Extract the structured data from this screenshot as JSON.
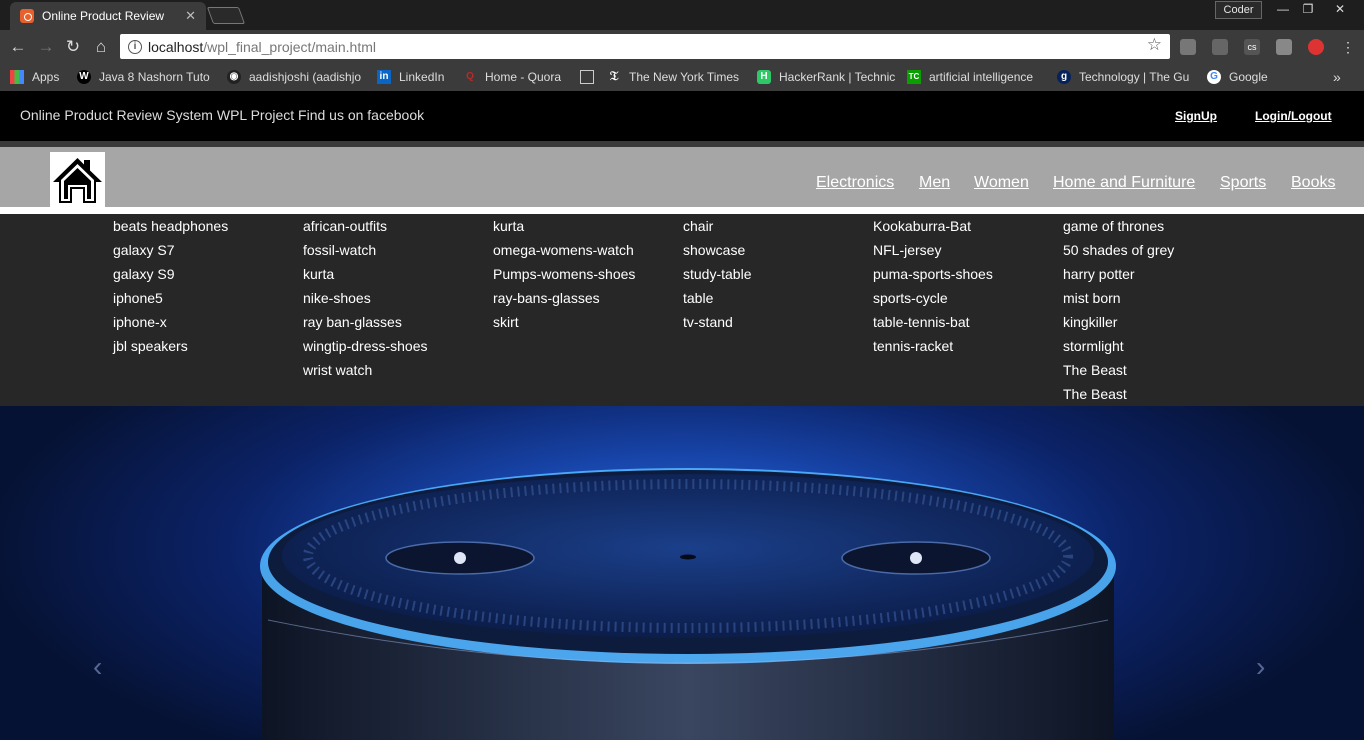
{
  "browser": {
    "tab_title": "Online Product Review",
    "profile": "Coder",
    "url_host": "localhost",
    "url_path": "/wpl_final_project/main.html",
    "bookmarks": [
      {
        "label": "Apps",
        "icon": "apps-grid-icon"
      },
      {
        "label": "Java 8 Nashorn Tuto",
        "icon": "w-icon"
      },
      {
        "label": "aadishjoshi (aadishjo",
        "icon": "github-icon"
      },
      {
        "label": "LinkedIn",
        "icon": "linkedin-icon"
      },
      {
        "label": "Home - Quora",
        "icon": "quora-icon"
      },
      {
        "label": "",
        "icon": "document-icon"
      },
      {
        "label": "The New York Times",
        "icon": "nyt-icon"
      },
      {
        "label": "HackerRank | Technic",
        "icon": "hackerrank-icon"
      },
      {
        "label": "artificial intelligence",
        "icon": "techcrunch-icon"
      },
      {
        "label": "Technology | The Gu",
        "icon": "guardian-icon"
      },
      {
        "label": "Google",
        "icon": "google-icon"
      }
    ],
    "more": "»"
  },
  "site": {
    "tagline_text": "Online Product Review System WPL Project ",
    "tagline_link": "Find us on facebook",
    "signup": "SignUp",
    "login": "Login/Logout",
    "nav": [
      "Electronics",
      "Men",
      "Women",
      "Home and Furniture",
      "Sports",
      "Books"
    ],
    "menu": [
      [
        "beats headphones",
        "galaxy S7",
        "galaxy S9",
        "iphone5",
        "iphone-x",
        "jbl speakers"
      ],
      [
        "african-outfits",
        "fossil-watch",
        "kurta",
        "nike-shoes",
        "ray ban-glasses",
        "wingtip-dress-shoes",
        "wrist watch"
      ],
      [
        "kurta",
        "omega-womens-watch",
        "Pumps-womens-shoes",
        "ray-bans-glasses",
        "skirt"
      ],
      [
        "chair",
        "showcase",
        "study-table",
        "table",
        "tv-stand"
      ],
      [
        "Kookaburra-Bat",
        "NFL-jersey",
        "puma-sports-shoes",
        "sports-cycle",
        "table-tennis-bat",
        "tennis-racket"
      ],
      [
        "game of thrones",
        "50 shades of grey",
        "harry potter",
        "mist born",
        "kingkiller",
        "stormlight",
        "The Beast",
        "The Beast"
      ]
    ],
    "carousel": {
      "prev": "‹",
      "next": "›"
    }
  }
}
